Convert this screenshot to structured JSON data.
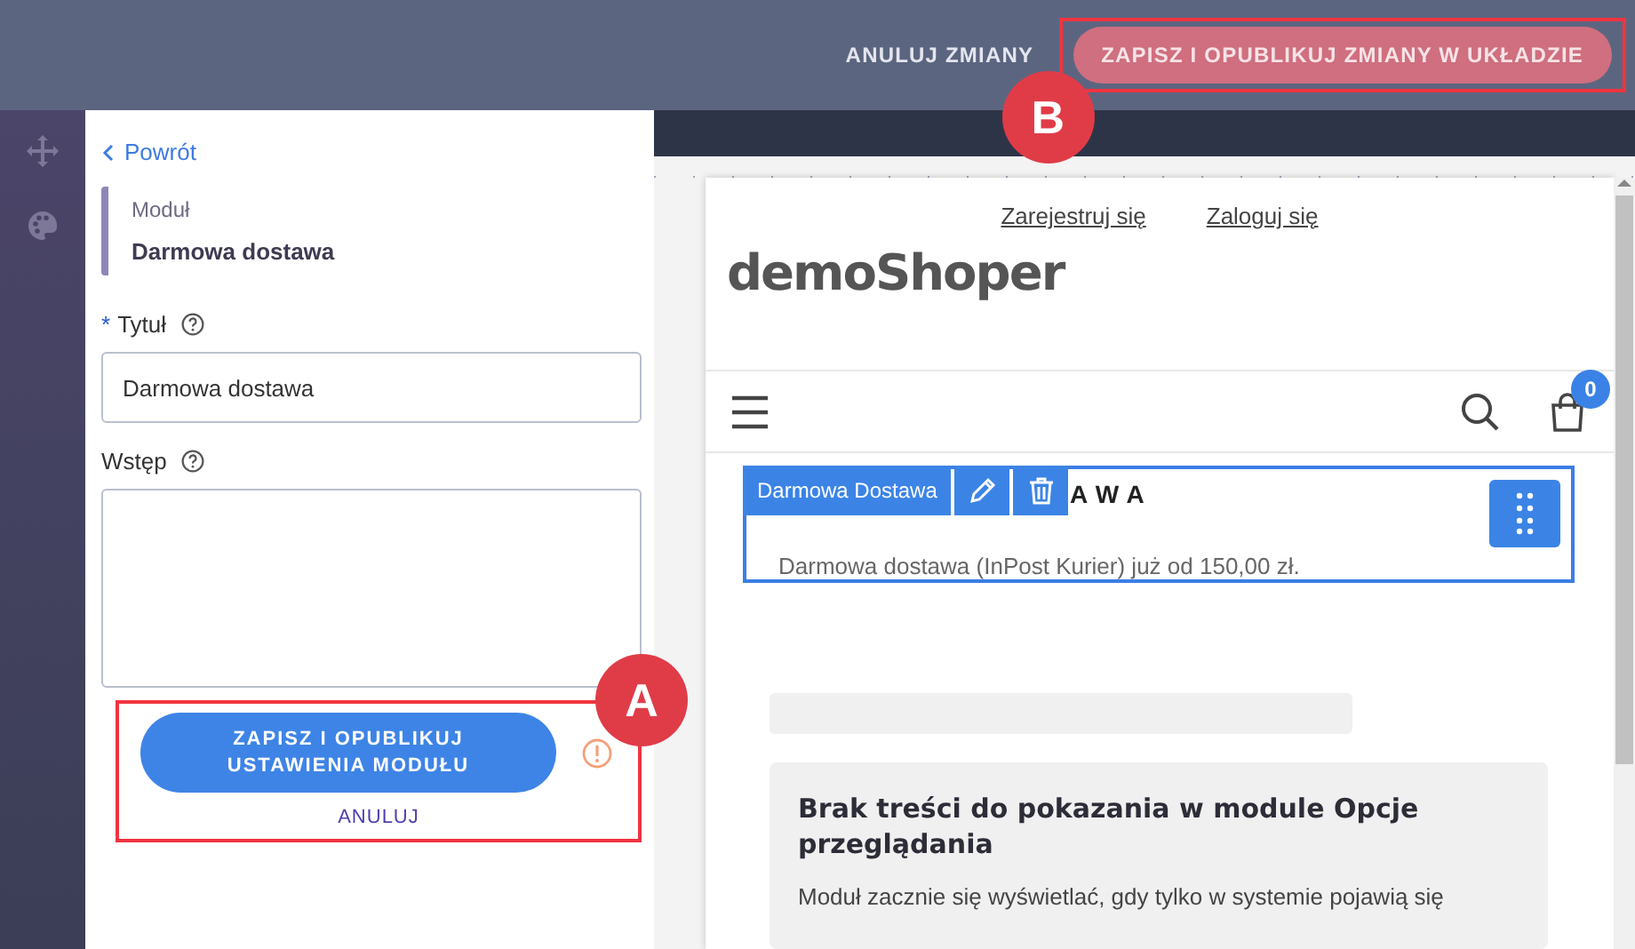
{
  "topbar": {
    "cancel_button": "ANULUJ ZMIANY",
    "publish_button": "ZAPISZ I OPUBLIKUJ ZMIANY W UKŁADZIE"
  },
  "panel": {
    "back_link": "Powrót",
    "module_label": "Moduł",
    "module_name": "Darmowa dostawa",
    "fields": [
      {
        "kind": "input",
        "required_mark": "*",
        "label": "Tytuł",
        "value": "Darmowa dostawa"
      },
      {
        "kind": "textarea",
        "label": "Wstęp"
      }
    ],
    "save_button": "ZAPISZ I OPUBLIKUJ USTAWIENIA MODUŁU",
    "cancel_link": "ANULUJ"
  },
  "preview": {
    "header_links": [
      "Zarejestruj się",
      "Zaloguj się"
    ],
    "logo": "demoShoper",
    "cart_count": "0",
    "module_toolbar_label": "Darmowa Dostawa",
    "module_heading": "AWA",
    "module_text": "Darmowa dostawa (InPost Kurier) już od 150,00 zł.",
    "empty_title": "Brak treści do pokazania w module Opcje przeglądania",
    "empty_text": "Moduł zacznie się wyświetlać, gdy tylko w systemie pojawią się"
  },
  "callouts": [
    {
      "label": "A"
    },
    {
      "label": "B"
    }
  ]
}
